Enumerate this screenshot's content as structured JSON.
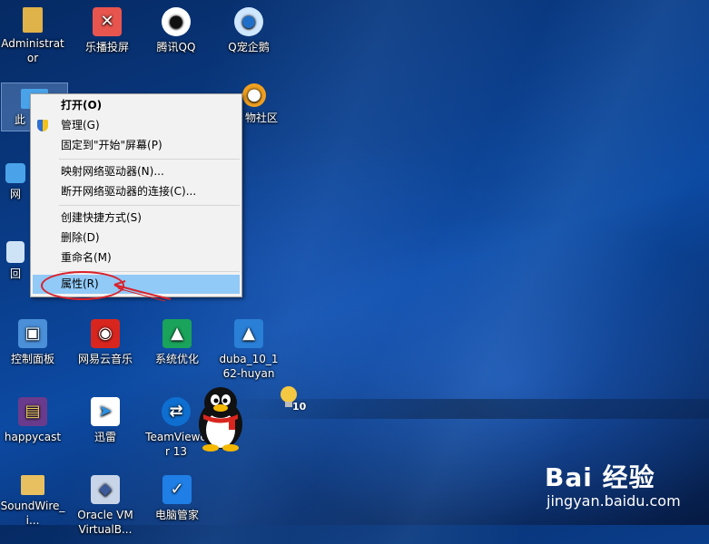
{
  "desktop": {
    "icons": [
      {
        "label": "Administrator",
        "glyph": "",
        "color": "#e0b24a"
      },
      {
        "label": "乐播投屏",
        "glyph": "✕",
        "color": "#e8554e"
      },
      {
        "label": "腾讯QQ",
        "glyph": "●",
        "color": "#111111"
      },
      {
        "label": "Q宠企鹅",
        "glyph": "●",
        "color": "#1f6fc8"
      },
      {
        "label": "此",
        "glyph": "",
        "color": "#4aa3e8"
      },
      {
        "label": "物社区",
        "glyph": "●",
        "color": "#f0a020"
      },
      {
        "label": "网",
        "glyph": "",
        "color": "#4aa3e8"
      },
      {
        "label": "回",
        "glyph": "",
        "color": "#cfe3f7"
      },
      {
        "label": "控制面板",
        "glyph": "▣",
        "color": "#4a8fd8"
      },
      {
        "label": "网易云音乐",
        "glyph": "◉",
        "color": "#d8261f"
      },
      {
        "label": "系统优化",
        "glyph": "▲",
        "color": "#1aa35a"
      },
      {
        "label": "duba_10_162-huyan",
        "glyph": "▲",
        "color": "#2a7fd6"
      },
      {
        "label": "happycast",
        "glyph": "▤",
        "color": "#6a3b8c"
      },
      {
        "label": "迅雷",
        "glyph": "➤",
        "color": "#2c8fe0"
      },
      {
        "label": "TeamViewer 13",
        "glyph": "⇄",
        "color": "#0e6fd1"
      },
      {
        "label": "SoundWire_i...",
        "glyph": "",
        "color": "#e8c060"
      },
      {
        "label": "Oracle VM VirtualB...",
        "glyph": "◆",
        "color": "#3c5a9a"
      },
      {
        "label": "电脑管家",
        "glyph": "✓",
        "color": "#1f7fe6"
      }
    ]
  },
  "context_menu": {
    "items": [
      {
        "label": "打开(O)"
      },
      {
        "label": "管理(G)"
      },
      {
        "label": "固定到\"开始\"屏幕(P)"
      },
      {
        "label": "映射网络驱动器(N)..."
      },
      {
        "label": "断开网络驱动器的连接(C)..."
      },
      {
        "label": "创建快捷方式(S)"
      },
      {
        "label": "删除(D)"
      },
      {
        "label": "重命名(M)"
      },
      {
        "label": "属性(R)"
      }
    ]
  },
  "desktop_overlay": {
    "bulb_badge": "10"
  },
  "watermark": {
    "brand": "Bai 经验",
    "url": "jingyan.baidu.com"
  }
}
